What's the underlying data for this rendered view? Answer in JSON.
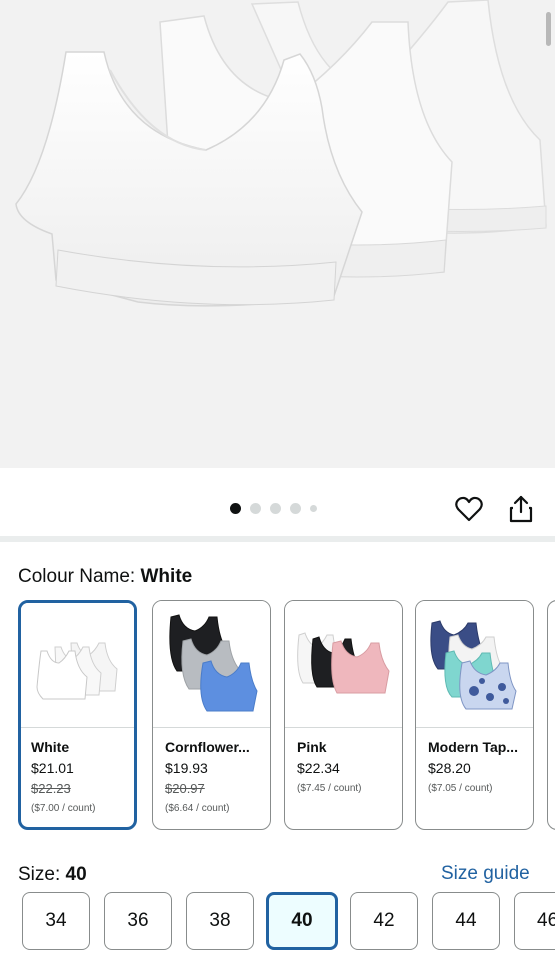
{
  "gallery": {
    "image_name": "white-three-pack-bras",
    "dot_count": 5,
    "active_dot": 0
  },
  "actions": {
    "favorite_icon": "heart-icon",
    "share_icon": "share-icon"
  },
  "colour": {
    "label": "Colour Name: ",
    "selected": "White",
    "options": [
      {
        "name": "White",
        "price": "$21.01",
        "list_price": "$22.23",
        "unit_price": "($7.00 / count)",
        "selected": true
      },
      {
        "name": "Cornflower...",
        "price": "$19.93",
        "list_price": "$20.97",
        "unit_price": "($6.64 / count)",
        "selected": false
      },
      {
        "name": "Pink",
        "price": "$22.34",
        "list_price": "",
        "unit_price": "($7.45 / count)",
        "selected": false
      },
      {
        "name": "Modern Tap...",
        "price": "$28.20",
        "list_price": "",
        "unit_price": "($7.05 / count)",
        "selected": false
      }
    ]
  },
  "size": {
    "label": "Size: ",
    "selected": "40",
    "guide_link": "Size guide",
    "options": [
      "34",
      "36",
      "38",
      "40",
      "42",
      "44",
      "46"
    ]
  },
  "colors": {
    "accent": "#2162a1",
    "selected_bg": "#edfdff",
    "border": "#888c8c"
  }
}
